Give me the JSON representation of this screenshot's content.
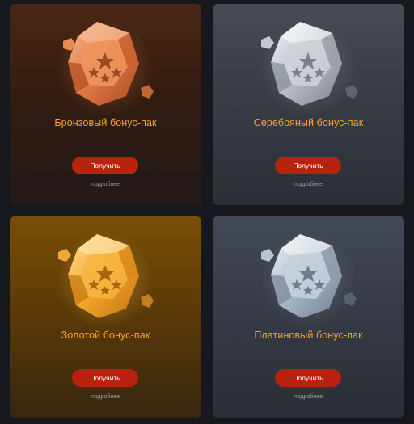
{
  "packs": [
    {
      "title": "Бронзовый бонус-пак",
      "button_label": "Получить",
      "details_label": "подробнее",
      "gem_icon": "bronze-gem-icon",
      "colors": {
        "gem_light": "#f3a070",
        "gem_mid": "#e07a45",
        "gem_dark": "#b5532a",
        "star": "#9b4a28"
      }
    },
    {
      "title": "Серебряный бонус-пак",
      "button_label": "Получить",
      "details_label": "подробнее",
      "gem_icon": "silver-gem-icon",
      "colors": {
        "gem_light": "#e8eaee",
        "gem_mid": "#b7bcc4",
        "gem_dark": "#8a9098",
        "star": "#7b8189"
      }
    },
    {
      "title": "Золотой бонус-пак",
      "button_label": "Получить",
      "details_label": "подробнее",
      "gem_icon": "gold-gem-icon",
      "colors": {
        "gem_light": "#ffd27a",
        "gem_mid": "#f4a62a",
        "gem_dark": "#c57a12",
        "star": "#a86812"
      }
    },
    {
      "title": "Платиновый бонус-пак",
      "button_label": "Получить",
      "details_label": "подробнее",
      "gem_icon": "platinum-gem-icon",
      "colors": {
        "gem_light": "#dfe8f0",
        "gem_mid": "#a7b6c4",
        "gem_dark": "#748594",
        "star": "#6d7d8c"
      }
    }
  ],
  "accent": {
    "title": "#f4a428",
    "button": "#b8230f"
  }
}
